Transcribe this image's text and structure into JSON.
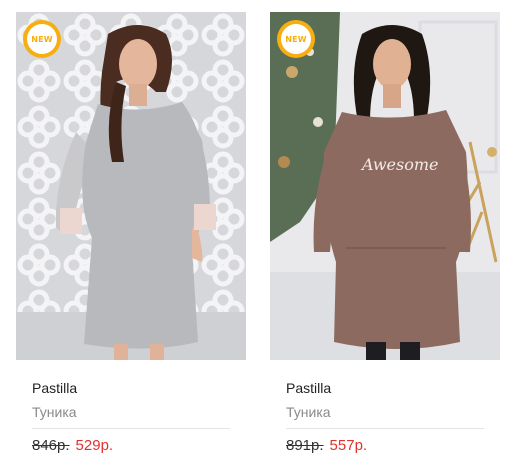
{
  "products": [
    {
      "badge": "NEW",
      "brand": "Pastilla",
      "type": "Туника",
      "old_price": "846р.",
      "new_price": "529р.",
      "image": "woman-in-grey-tunic"
    },
    {
      "badge": "NEW",
      "brand": "Pastilla",
      "type": "Туника",
      "old_price": "891р.",
      "new_price": "557р.",
      "image": "woman-in-brown-tunic",
      "print": "Awesome"
    }
  ],
  "colors": {
    "badge": "#f6ae10",
    "sale_price": "#e0322f",
    "old_price": "#333333",
    "brand_text": "#222222",
    "type_text": "#8a8a8a"
  }
}
